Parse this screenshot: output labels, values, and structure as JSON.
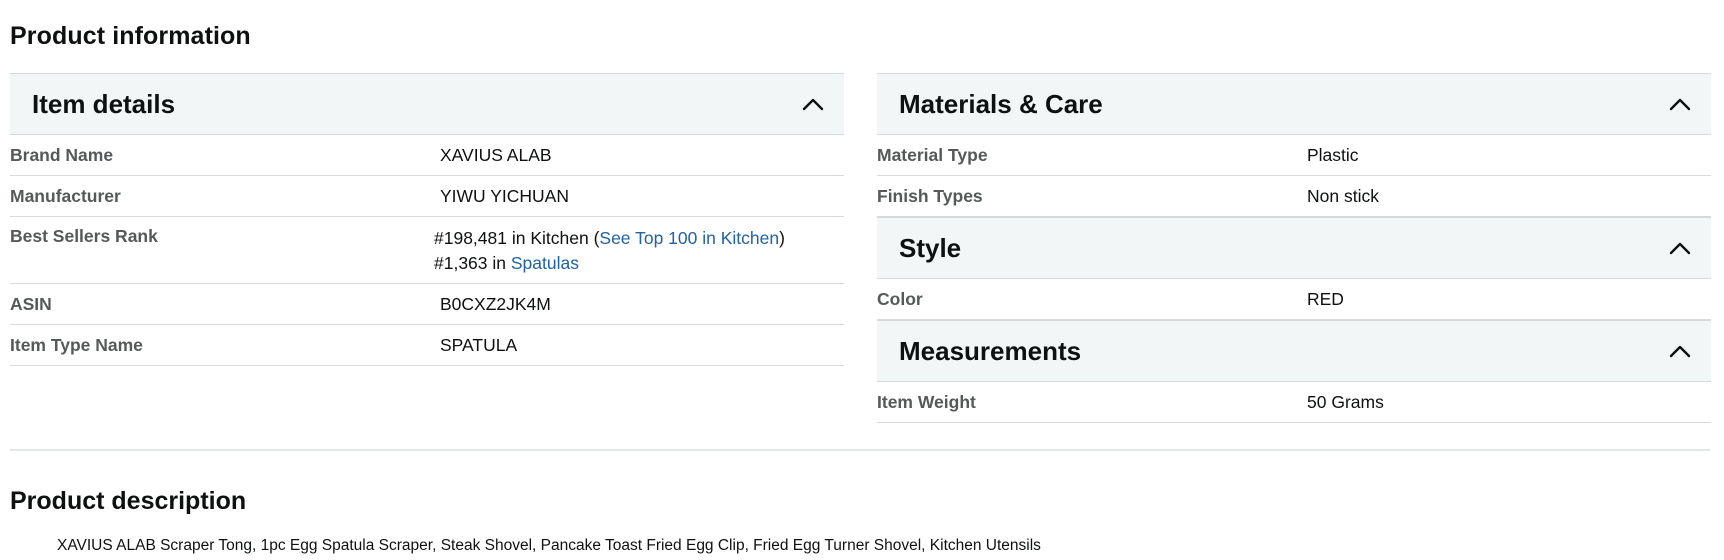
{
  "page_title": "Product information",
  "item_details": {
    "title": "Item details",
    "rows": [
      {
        "label": "Brand Name",
        "value": "XAVIUS ALAB"
      },
      {
        "label": "Manufacturer",
        "value": "YIWU YICHUAN"
      },
      {
        "label": "Best Sellers Rank",
        "rank1_prefix": "#198,481 in Kitchen (",
        "rank1_link": "See Top 100 in Kitchen",
        "rank1_suffix": ")",
        "rank2_prefix": "#1,363 in ",
        "rank2_link": "Spatulas"
      },
      {
        "label": "ASIN",
        "value": "B0CXZ2JK4M"
      },
      {
        "label": "Item Type Name",
        "value": "SPATULA"
      }
    ]
  },
  "materials_care": {
    "title": "Materials & Care",
    "rows": [
      {
        "label": "Material Type",
        "value": "Plastic"
      },
      {
        "label": "Finish Types",
        "value": "Non stick"
      }
    ]
  },
  "style": {
    "title": "Style",
    "rows": [
      {
        "label": "Color",
        "value": "RED"
      }
    ]
  },
  "measurements": {
    "title": "Measurements",
    "rows": [
      {
        "label": "Item Weight",
        "value": "50 Grams"
      }
    ]
  },
  "product_description": {
    "title": "Product description",
    "text": "XAVIUS ALAB Scraper Tong, 1pc Egg Spatula Scraper, Steak Shovel, Pancake Toast Fried Egg Clip, Fried Egg Turner Shovel, Kitchen Utensils"
  },
  "icons": {
    "collapse": "chevron-up-icon"
  },
  "colors": {
    "header_bg": "#f3f6f7",
    "label": "#565959",
    "link": "#2162a1",
    "border": "#d5dbdb"
  }
}
